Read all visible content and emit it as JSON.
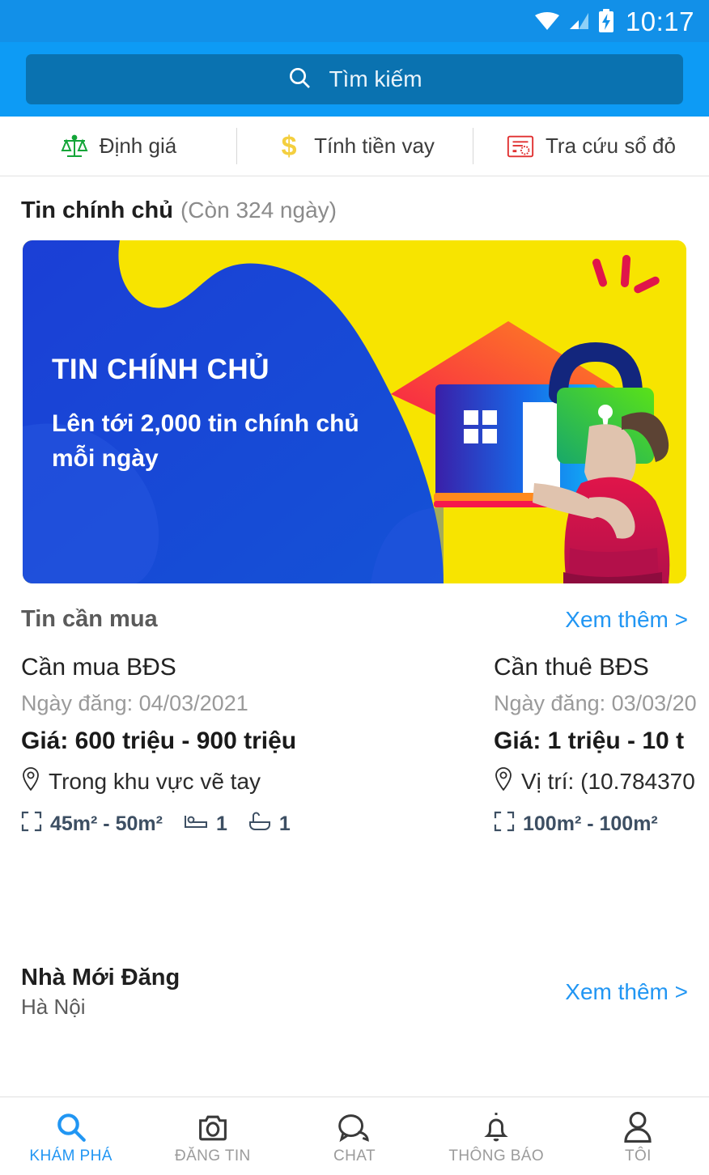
{
  "statusbar": {
    "time": "10:17",
    "icons": [
      "wifi-icon",
      "cell-signal-icon",
      "battery-charging-icon"
    ]
  },
  "search": {
    "placeholder": "Tìm kiếm",
    "icon": "search-icon"
  },
  "quick_actions": [
    {
      "label": "Định giá",
      "icon": "balance-scale-icon",
      "color": "#13a538"
    },
    {
      "label": "Tính tiền vay",
      "icon": "dollar-sign-icon",
      "color": "#f4cf3f"
    },
    {
      "label": "Tra cứu sổ đỏ",
      "icon": "red-certificate-icon",
      "color": "#e03030"
    }
  ],
  "owner_section": {
    "title": "Tin chính chủ",
    "subtitle": "(Còn 324 ngày)",
    "banner": {
      "heading": "TIN CHÍNH CHỦ",
      "body": "Lên tới 2,000 tin chính chủ mỗi ngày",
      "bg_yellow": "#f7e400",
      "bg_blue": "#1b3fd6",
      "house_roof": "#f6482c",
      "lock_body": "#35b53a",
      "shirt": "#e0154a"
    }
  },
  "buy_section": {
    "title": "Tin cần mua",
    "more_label": "Xem thêm >",
    "cards": [
      {
        "title": "Cần mua BĐS",
        "date": "Ngày đăng: 04/03/2021",
        "price": "Giá: 600 triệu - 900 triệu",
        "location": "Trong khu vực vẽ tay",
        "area": "45m² - 50m²",
        "bedrooms": "1",
        "bathrooms": "1"
      },
      {
        "title": "Cần thuê BĐS",
        "date": "Ngày đăng: 03/03/20",
        "price": "Giá: 1 triệu - 10 t",
        "location": "Vị trí: (10.784370",
        "area": "100m² - 100m²",
        "bedrooms": "",
        "bathrooms": ""
      }
    ]
  },
  "new_section": {
    "title": "Nhà Mới Đăng",
    "city": "Hà Nội",
    "more_label": "Xem thêm >"
  },
  "bottom_nav": [
    {
      "label": "KHÁM PHÁ",
      "icon": "search-icon",
      "active": true
    },
    {
      "label": "ĐĂNG TIN",
      "icon": "camera-icon",
      "active": false
    },
    {
      "label": "CHAT",
      "icon": "chat-bubbles-icon",
      "active": false
    },
    {
      "label": "THÔNG BÁO",
      "icon": "bell-icon",
      "active": false
    },
    {
      "label": "TÔI",
      "icon": "person-icon",
      "active": false
    }
  ],
  "colors": {
    "header_blue": "#0d9bf5",
    "statusbar_blue": "#1290e8",
    "searchbox_blue": "#0a72b0",
    "link_blue": "#2196f3",
    "spec_slate": "#3d4f63"
  }
}
